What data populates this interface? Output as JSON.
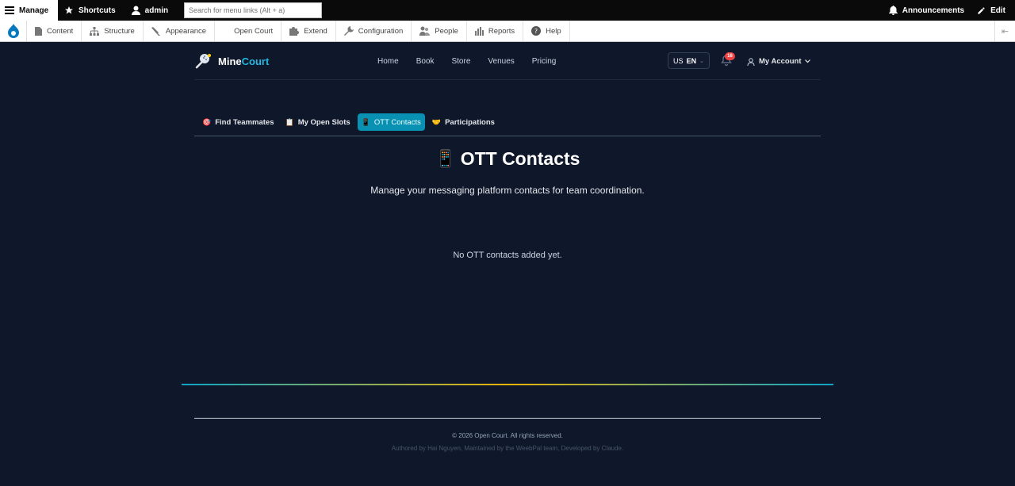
{
  "admin_toolbar": {
    "manage": "Manage",
    "shortcuts": "Shortcuts",
    "user": "admin",
    "search_placeholder": "Search for menu links (Alt + a)",
    "announcements": "Announcements",
    "edit": "Edit"
  },
  "tray": {
    "items": [
      "Content",
      "Structure",
      "Appearance",
      "Open Court",
      "Extend",
      "Configuration",
      "People",
      "Reports",
      "Help"
    ]
  },
  "site": {
    "logo_part1": "Mine",
    "logo_part2": "Court",
    "nav": [
      "Home",
      "Book",
      "Store",
      "Venues",
      "Pricing"
    ],
    "lang_flag": "US",
    "lang_code": "EN",
    "notification_count": "16",
    "account_label": "My Account"
  },
  "tabs": [
    {
      "icon": "🎯",
      "label": "Find Teammates"
    },
    {
      "icon": "📋",
      "label": "My Open Slots"
    },
    {
      "icon": "📱",
      "label": "OTT Contacts"
    },
    {
      "icon": "🤝",
      "label": "Participations"
    }
  ],
  "page": {
    "title_icon": "📱",
    "title": "OTT Contacts",
    "subtitle": "Manage your messaging platform contacts for team coordination.",
    "empty_message": "No OTT contacts added yet."
  },
  "footer": {
    "copyright": "© 2026 Open Court. All rights reserved.",
    "authored": "Authored by Hai Nguyen, Maintained by the WeebPal team, Developed by Claude."
  },
  "colors": {
    "background": "#0f172a",
    "accent": "#0891b2",
    "brand_court": "#22b8e0",
    "badge": "#ef4444"
  }
}
